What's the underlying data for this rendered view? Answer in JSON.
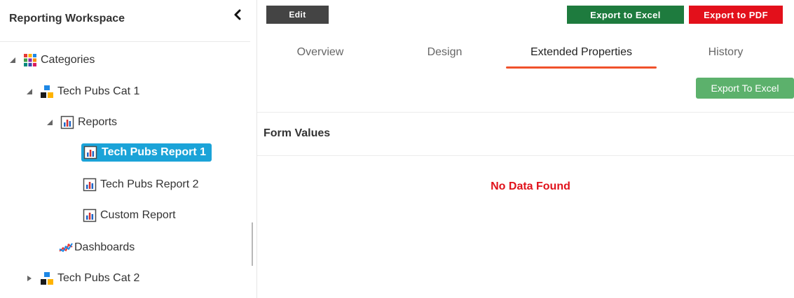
{
  "sidebar": {
    "title": "Reporting Workspace",
    "collapse_icon": "chevron-left-icon",
    "tree": {
      "categories": {
        "label": "Categories",
        "icon": "grid-icon",
        "expanded": true
      },
      "cat1": {
        "label": "Tech Pubs Cat 1",
        "icon": "category-icon",
        "expanded": true
      },
      "reports": {
        "label": "Reports",
        "icon": "report-icon",
        "expanded": true
      },
      "report1": {
        "label": "Tech Pubs Report 1",
        "icon": "report-icon",
        "selected": true
      },
      "report2": {
        "label": "Tech Pubs Report 2",
        "icon": "report-icon"
      },
      "custom": {
        "label": "Custom Report",
        "icon": "report-icon"
      },
      "dashboards": {
        "label": "Dashboards",
        "icon": "line-chart-icon"
      },
      "cat2": {
        "label": "Tech Pubs Cat 2",
        "icon": "category-icon",
        "expanded": false
      }
    }
  },
  "toolbar": {
    "edit_label": "Edit",
    "export_excel_label": "Export to Excel",
    "export_pdf_label": "Export to PDF"
  },
  "tabs": [
    {
      "label": "Overview",
      "active": false
    },
    {
      "label": "Design",
      "active": false
    },
    {
      "label": "Extended Properties",
      "active": true
    },
    {
      "label": "History",
      "active": false
    }
  ],
  "content": {
    "export_to_excel_label": "Export To Excel",
    "form_values_label": "Form Values",
    "no_data_label": "No Data Found"
  },
  "colors": {
    "selected_node": "#1ba3d8",
    "edit_button": "#444444",
    "export_excel_button": "#1e7b3e",
    "export_pdf_button": "#e3101b",
    "active_tab_underline": "#f0512b",
    "export_small_button": "#5cb16c",
    "no_data_text": "#e0121b"
  }
}
